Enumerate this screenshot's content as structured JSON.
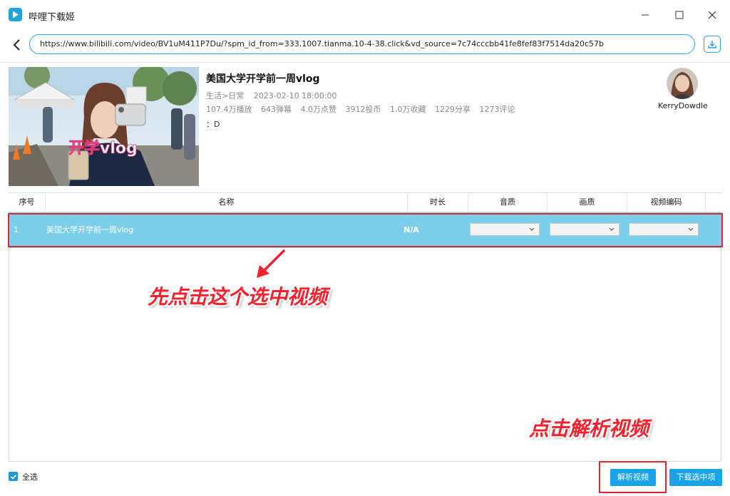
{
  "window": {
    "title": "哔哩下载姬",
    "accent": "#1fa5db"
  },
  "address": {
    "url": "https://www.bilibili.com/video/BV1uM411P7Du/?spm_id_from=333.1007.tianma.10-4-38.click&vd_source=7c74cccbb41fe8fef83f7514da20c57b"
  },
  "video": {
    "title": "美国大学开学前一周vlog",
    "category": "生活>日常",
    "date": "2023-02-10 18:00:00",
    "stats": [
      "107.4万播放",
      "643弹幕",
      "4.0万点赞",
      "3912投币",
      "1.0万收藏",
      "1229分享",
      "1273评论"
    ],
    "description": "：D",
    "thumbnail_caption": "开学vlog",
    "uploader": "KerryDowdle"
  },
  "table": {
    "headers": {
      "index": "序号",
      "name": "名称",
      "duration": "时长",
      "audio": "音质",
      "video": "画质",
      "codec": "视频编码"
    },
    "rows": [
      {
        "index": "1",
        "name": "美国大学开学前一周vlog",
        "duration": "N/A",
        "audio": "",
        "video": "",
        "codec": ""
      }
    ],
    "row_selected_color": "#7bcfea"
  },
  "annotations": {
    "select_hint": "先点击这个选中视频",
    "parse_hint": "点击解析视频",
    "color": "#f5222d"
  },
  "footer": {
    "select_all": "全选",
    "select_all_checked": true,
    "parse_button": "解析视频",
    "download_selected_button": "下载选中项",
    "button_color": "#19a3e6"
  }
}
